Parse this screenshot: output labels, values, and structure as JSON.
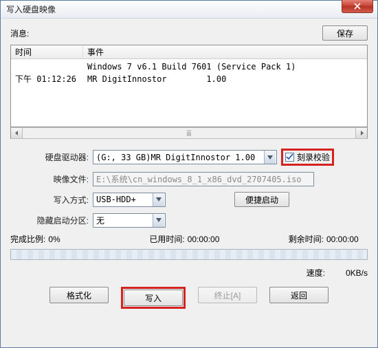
{
  "window": {
    "title": "写入硬盘映像"
  },
  "toolbar": {
    "message_label": "消息:",
    "save_label": "保存"
  },
  "log": {
    "col_time": "时间",
    "col_event": "事件",
    "rows": [
      {
        "time": "",
        "event": "Windows 7 v6.1 Build 7601 (Service Pack 1)"
      },
      {
        "time": "下午 01:12:26",
        "event": "MR DigitInnostor        1.00"
      }
    ],
    "hscroll_marker": "ⅲ"
  },
  "form": {
    "drive_label": "硬盘驱动器:",
    "drive_value": "(G:, 33 GB)MR DigitInnostor        1.00",
    "verify_label": "刻录校验",
    "verify_checked": true,
    "image_label": "映像文件:",
    "image_value": "E:\\系统\\cn_windows_8_1_x86_dvd_2707405.iso",
    "method_label": "写入方式:",
    "method_value": "USB-HDD+",
    "quick_label": "便捷启动",
    "hidden_label": "隐藏启动分区:",
    "hidden_value": "无"
  },
  "progress": {
    "percent_label": "完成比例:",
    "percent_value": "0%",
    "elapsed_label": "已用时间:",
    "elapsed_value": "00:00:00",
    "remaining_label": "剩余时间:",
    "remaining_value": "00:00:00",
    "speed_label": "速度:",
    "speed_value": "0KB/s"
  },
  "actions": {
    "format": "格式化",
    "write": "写入",
    "abort": "终止[A]",
    "back": "返回"
  }
}
